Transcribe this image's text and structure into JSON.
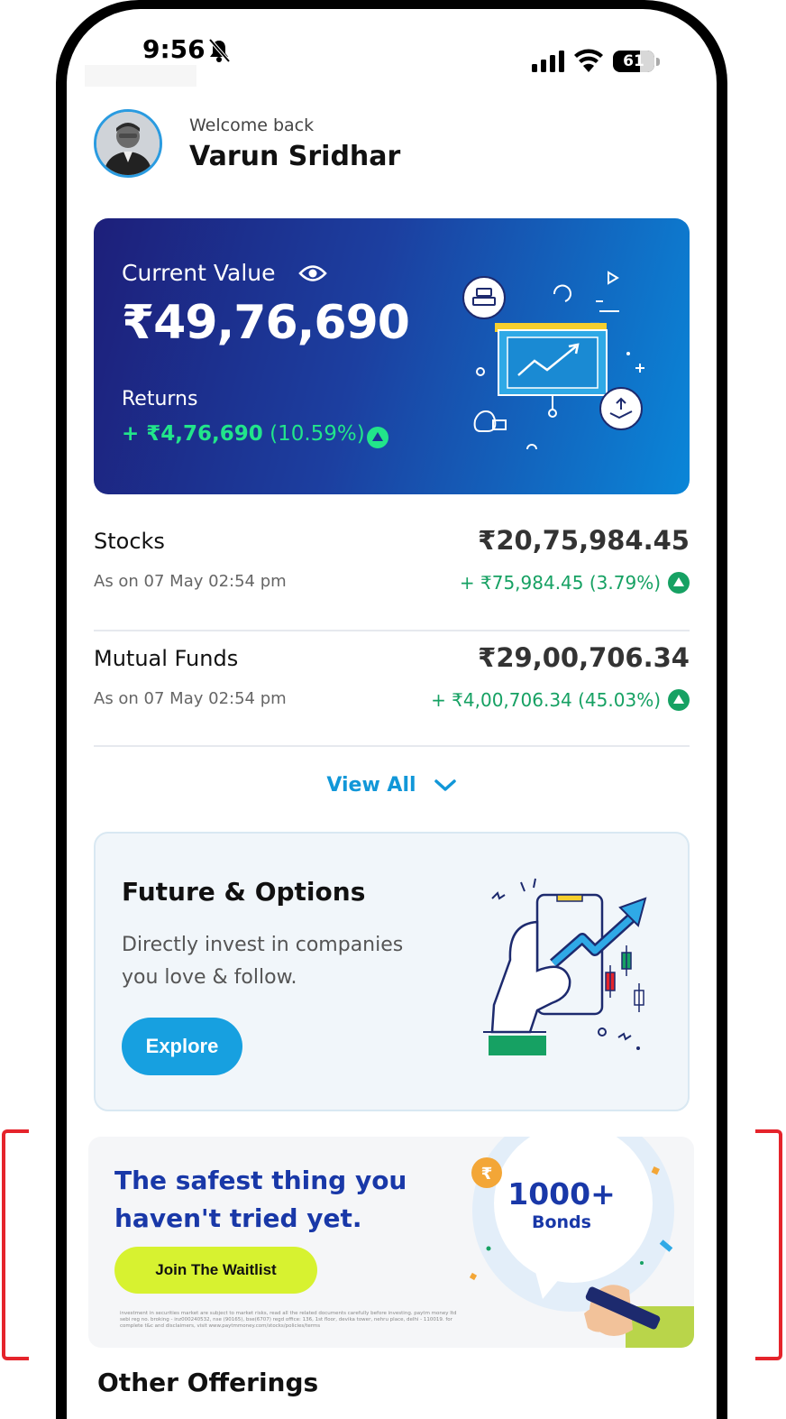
{
  "status_bar": {
    "time": "9:56",
    "battery": "61"
  },
  "header": {
    "welcome": "Welcome back",
    "name": "Varun Sridhar"
  },
  "portfolio": {
    "current_value_label": "Current Value",
    "current_value": "₹49,76,690",
    "returns_label": "Returns",
    "returns_amount": "+ ₹4,76,690",
    "returns_percent": " (10.59%)"
  },
  "holdings": [
    {
      "title": "Stocks",
      "date": "As on 07 May 02:54 pm",
      "amount": "₹20,75,984.45",
      "change": "+ ₹75,984.45 (3.79%)"
    },
    {
      "title": "Mutual Funds",
      "date": "As on 07 May 02:54 pm",
      "amount": "₹29,00,706.34",
      "change": "+ ₹4,00,706.34 (45.03%)"
    }
  ],
  "view_all": "View All",
  "fo_card": {
    "title": "Future & Options",
    "description": "Directly invest in companies you love & follow.",
    "cta": "Explore"
  },
  "bonds_banner": {
    "headline": "The safest thing you haven't tried yet.",
    "cta": "Join The Waitlist",
    "count": "1000+",
    "label": "Bonds",
    "disclaimer": "investment in securities market are subject to market risks, read all the related documents carefully before investing. paytm money ltd sebi reg no. broking - inz000240532, nse (90165), bse(6707) regd office: 136, 1st floor, devika tower, nehru place, delhi - 110019. for complete t&c and disclaimers, visit www.paytmmoney.com/stocks/policies/terms"
  },
  "other_offerings": "Other Offerings",
  "colors": {
    "brand_blue": "#1938a8",
    "accent_blue": "#17a0e0",
    "gain_green": "#16a163",
    "lime": "#d7f230",
    "highlight_red": "#e5242b"
  }
}
